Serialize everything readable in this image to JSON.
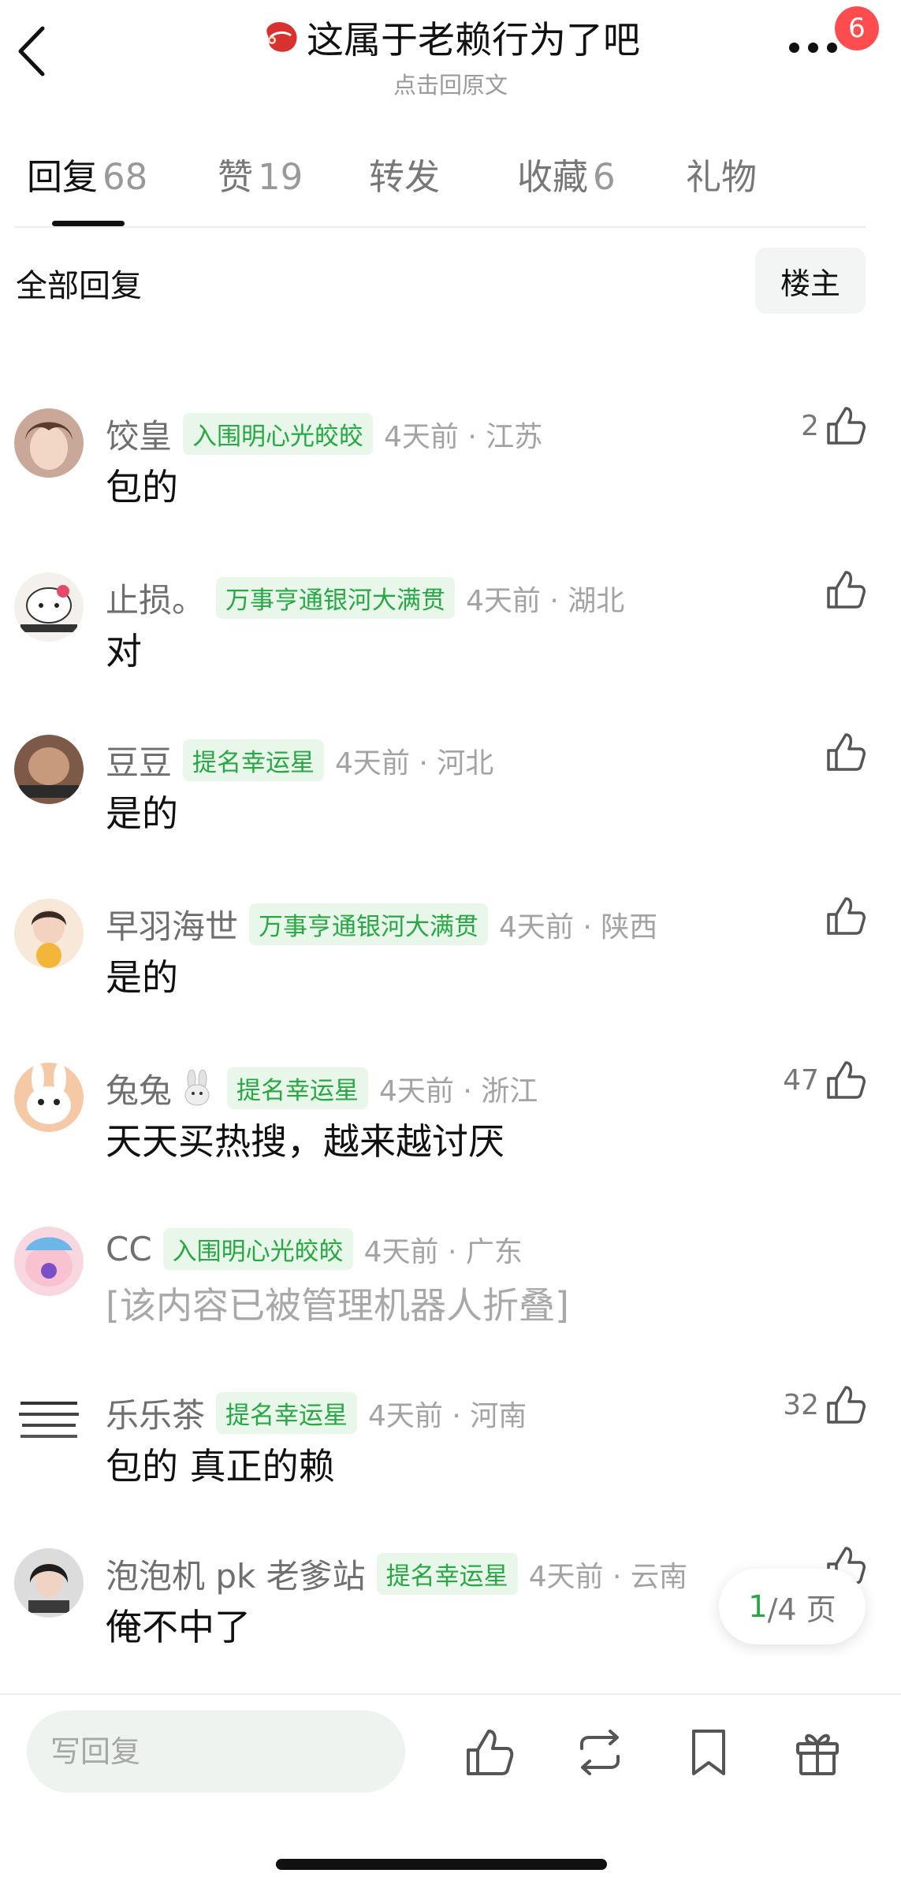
{
  "header": {
    "title": "这属于老赖行为了吧",
    "subtitle": "点击回原文",
    "notification_count": "6",
    "icons": [
      "back-arrow-icon",
      "steak-icon",
      "more-icon"
    ]
  },
  "tabs": [
    {
      "label": "回复",
      "count": "68"
    },
    {
      "label": "赞",
      "count": "19"
    },
    {
      "label": "转发",
      "count": ""
    },
    {
      "label": "收藏",
      "count": "6"
    },
    {
      "label": "礼物",
      "count": ""
    }
  ],
  "filter": {
    "label": "全部回复",
    "owner_button": "楼主"
  },
  "comments": [
    {
      "username": "饺皇",
      "tag": "入围明心光皎皎",
      "time": "4天前",
      "location": "江苏",
      "text": "包的",
      "likes": "2"
    },
    {
      "username": "止损。",
      "tag": "万事亨通银河大满贯",
      "time": "4天前",
      "location": "湖北",
      "text": "对",
      "likes": ""
    },
    {
      "username": "豆豆",
      "tag": "提名幸运星",
      "time": "4天前",
      "location": "河北",
      "text": "是的",
      "likes": ""
    },
    {
      "username": "早羽海世",
      "tag": "万事亨通银河大满贯",
      "time": "4天前",
      "location": "陕西",
      "text": "是的",
      "likes": ""
    },
    {
      "username": "兔兔",
      "tag": "提名幸运星",
      "time": "4天前",
      "location": "浙江",
      "text": "天天买热搜，越来越讨厌",
      "likes": "47"
    },
    {
      "username": "CC",
      "tag": "入围明心光皎皎",
      "time": "4天前",
      "location": "广东",
      "text": "[该内容已被管理机器人折叠]",
      "likes": ""
    },
    {
      "username": "乐乐茶",
      "tag": "提名幸运星",
      "time": "4天前",
      "location": "河南",
      "text": "包的 真正的赖",
      "likes": "32"
    },
    {
      "username": "泡泡机 pk 老爹站",
      "tag": "提名幸运星",
      "time": "4天前",
      "location": "云南",
      "text": "俺不中了",
      "likes": ""
    }
  ],
  "pager": {
    "current": "1",
    "total_text": "/4 页"
  },
  "bottom_bar": {
    "reply_placeholder": "写回复",
    "actions": [
      "like-icon",
      "repost-icon",
      "bookmark-icon",
      "gift-icon"
    ]
  },
  "colors": {
    "accent_green": "#27a844",
    "tag_bg": "#e9f7ea",
    "badge_red": "#ff4d4f"
  }
}
